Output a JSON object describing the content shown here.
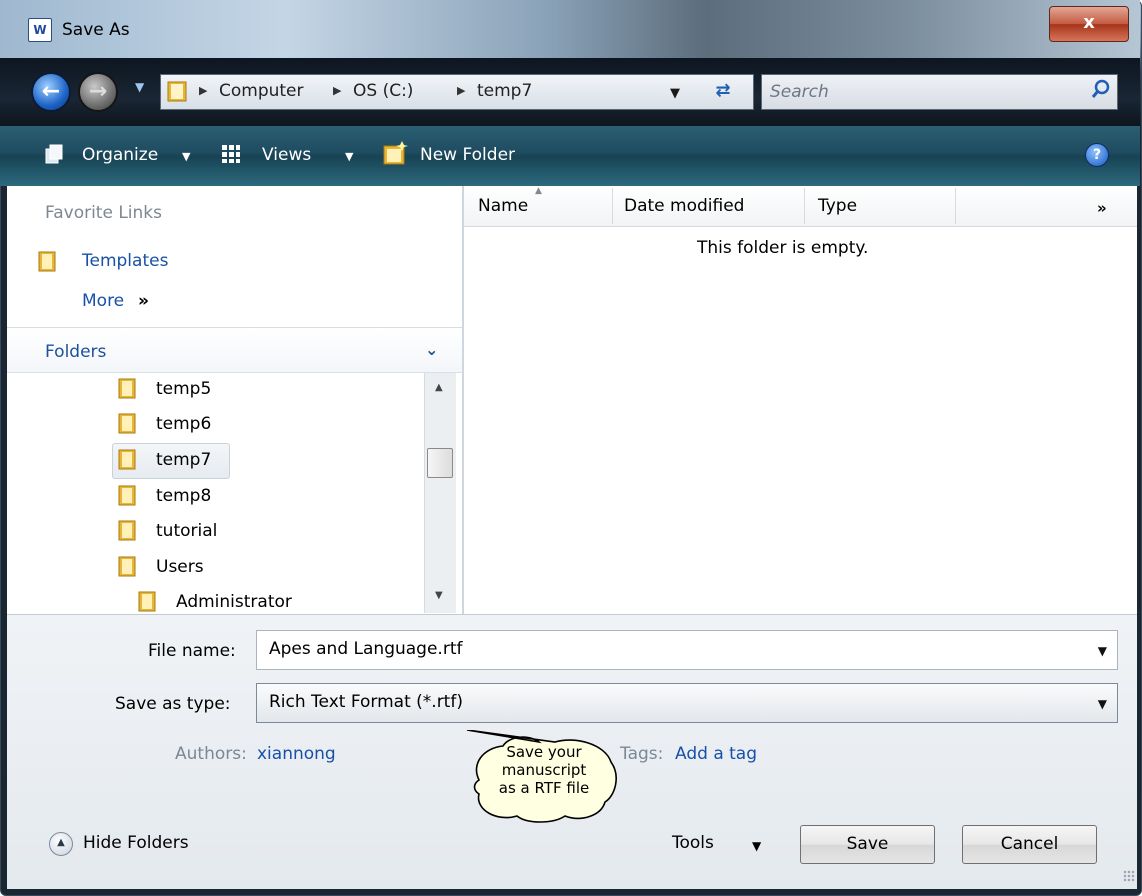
{
  "window": {
    "title": "Save As",
    "app_icon": "W",
    "close_label": "x"
  },
  "nav": {
    "breadcrumb": [
      "Computer",
      "OS (C:)",
      "temp7"
    ],
    "search_placeholder": "Search"
  },
  "toolbar": {
    "organize": "Organize",
    "views": "Views",
    "new_folder": "New Folder",
    "help": "?"
  },
  "favorites": {
    "header": "Favorite Links",
    "items": [
      "Templates"
    ],
    "more": "More",
    "more_glyph": "»"
  },
  "folders": {
    "header": "Folders",
    "items": [
      "temp5",
      "temp6",
      "temp7",
      "temp8",
      "tutorial",
      "Users",
      "Administrator"
    ],
    "selected": "temp7"
  },
  "filelist": {
    "columns": [
      "Name",
      "Date modified",
      "Type"
    ],
    "more_glyph": "»",
    "empty_message": "This folder is empty."
  },
  "form": {
    "filename_label": "File name:",
    "filename_value": "Apes and Language.rtf",
    "type_label": "Save as type:",
    "type_value": "Rich Text Format (*.rtf)",
    "authors_label": "Authors:",
    "authors_value": "xiannong",
    "tags_label": "Tags:",
    "tags_value": "Add a tag"
  },
  "callout": {
    "lines": [
      "Save your",
      "manuscript",
      "as a RTF file"
    ]
  },
  "footer": {
    "hide_folders": "Hide Folders",
    "tools": "Tools",
    "save": "Save",
    "cancel": "Cancel"
  },
  "colors": {
    "toolbar": "#1e4b5f",
    "link": "#1750a8",
    "close": "#c45a40",
    "callout_fill": "#ffffe1"
  }
}
